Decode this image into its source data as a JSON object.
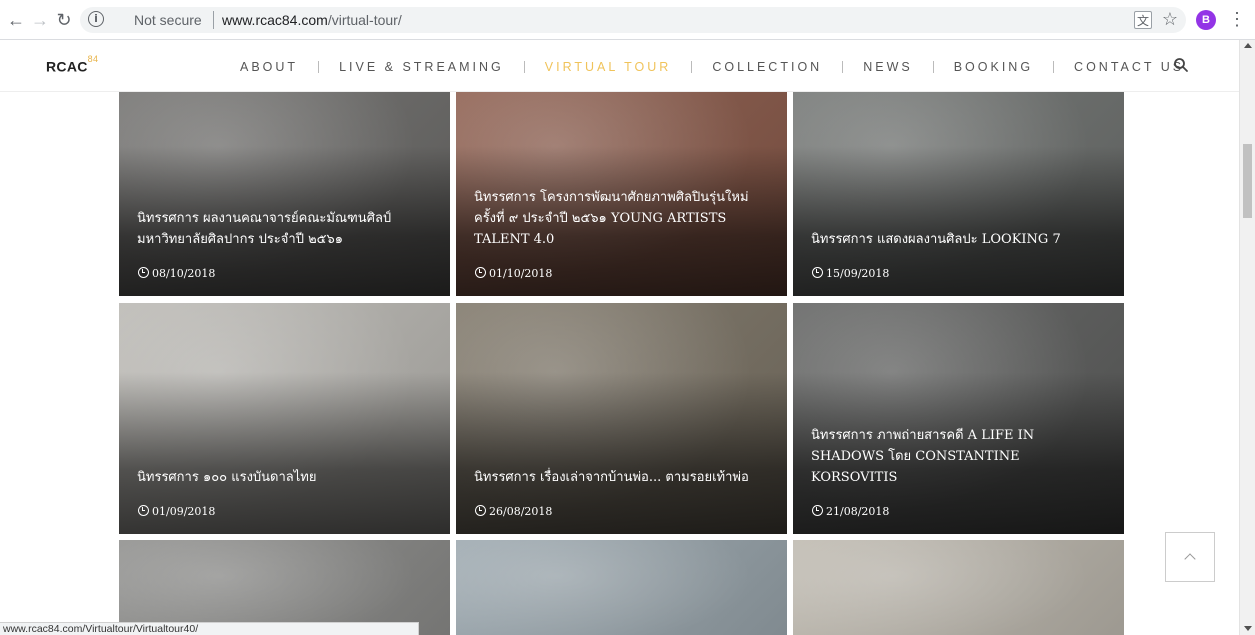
{
  "browser": {
    "not_secure": "Not secure",
    "url_host": "www.rcac84.com",
    "url_path": "/virtual-tour/",
    "profile_initial": "B",
    "status_url": "www.rcac84.com/Virtualtour/Virtualtour40/"
  },
  "header": {
    "logo_text": "RCAC",
    "logo_sup": "84",
    "nav": [
      {
        "label": "ABOUT",
        "active": false
      },
      {
        "label": "LIVE & STREAMING",
        "active": false
      },
      {
        "label": "VIRTUAL TOUR",
        "active": true
      },
      {
        "label": "COLLECTION",
        "active": false
      },
      {
        "label": "NEWS",
        "active": false
      },
      {
        "label": "BOOKING",
        "active": false
      },
      {
        "label": "CONTACT US",
        "active": false
      }
    ]
  },
  "cards": [
    {
      "title": "นิทรรศการ ผลงานคณาจารย์คณะมัณฑนศิลป์ มหาวิทยาลัยศิลปากร ประจำปี ๒๕๖๑",
      "date": "08/10/2018",
      "bg": "#6e6d6b"
    },
    {
      "title": "นิทรรศการ โครงการพัฒนาศักยภาพศิลปินรุ่นใหม่ ครั้งที่ ๙ ประจำปี ๒๕๖๑ YOUNG ARTISTS TALENT 4.0",
      "date": "01/10/2018",
      "bg": "#8a5a4a"
    },
    {
      "title": "นิทรรศการ แสดงผลงานศิลปะ LOOKING 7",
      "date": "15/09/2018",
      "bg": "#6f7270"
    },
    {
      "title": "นิทรรศการ ๑๐๐ แรงบันดาลไทย",
      "date": "01/09/2018",
      "bg": "#b9b7b2"
    },
    {
      "title": "นิทรรศการ เรื่องเล่าจากบ้านพ่อ... ตามรอยเท้าพ่อ",
      "date": "26/08/2018",
      "bg": "#7c7466"
    },
    {
      "title": "นิทรรศการ ภาพถ่ายสารคดี A LIFE IN SHADOWS โดย CONSTANTINE KORSOVITIS",
      "date": "21/08/2018",
      "bg": "#5e5f5e"
    },
    {
      "title": "",
      "date": "",
      "bg": "#8c8c8a"
    },
    {
      "title": "",
      "date": "",
      "bg": "#9aa6ad"
    },
    {
      "title": "",
      "date": "",
      "bg": "#bdb8ae"
    }
  ]
}
